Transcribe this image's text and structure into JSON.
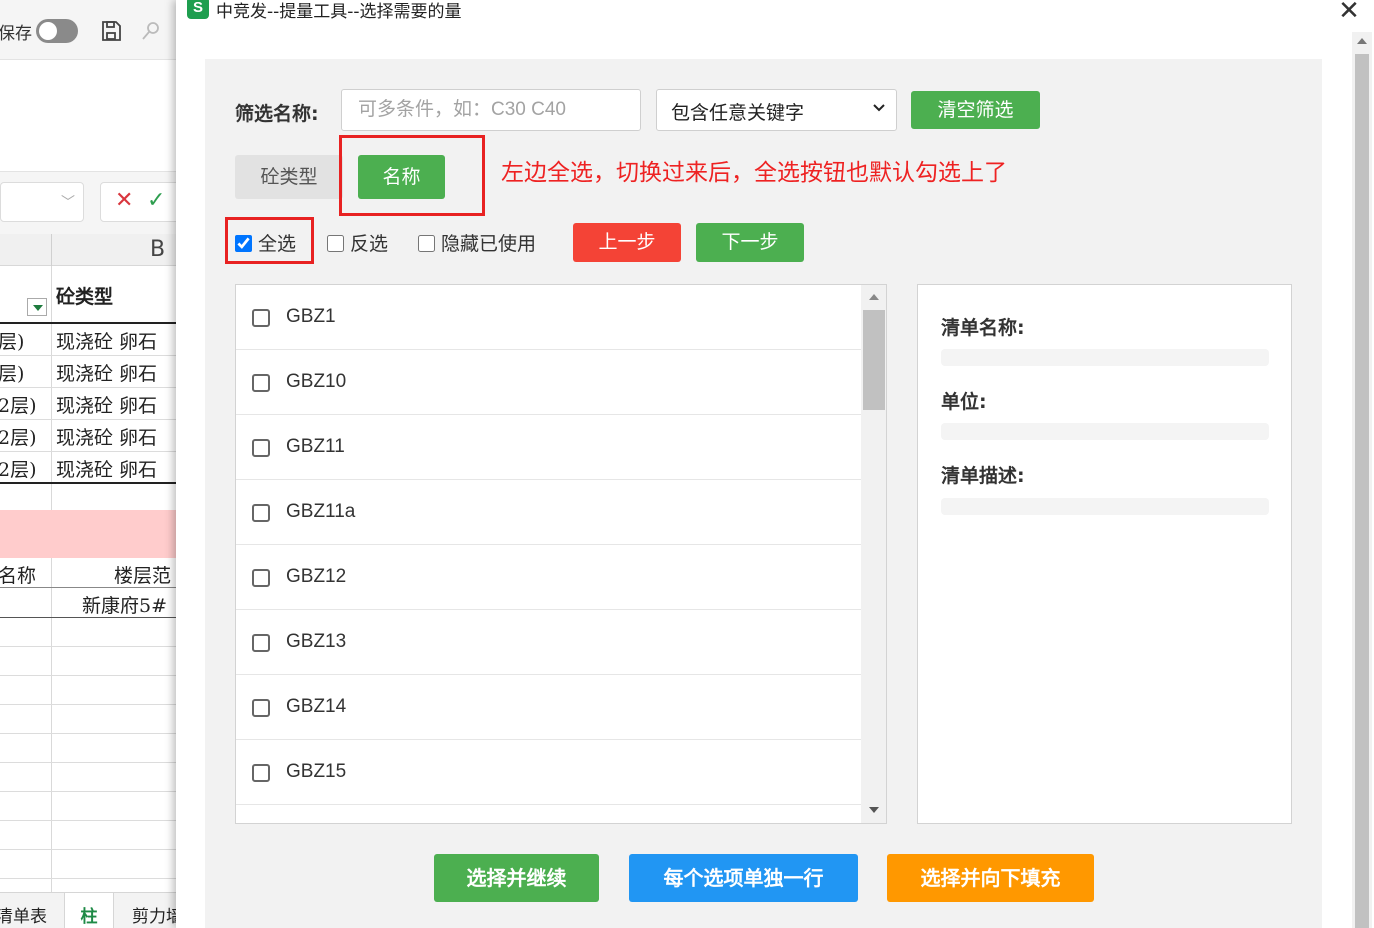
{
  "spreadsheet": {
    "autosave_label": "保存",
    "column_b_header": "B",
    "header_cell": "砼类型",
    "rows": [
      {
        "a": "层)",
        "b": "现浇砼 卵石"
      },
      {
        "a": "层)",
        "b": "现浇砼 卵石"
      },
      {
        "a": "2层)",
        "b": "现浇砼 卵石"
      },
      {
        "a": "2层)",
        "b": "现浇砼 卵石"
      },
      {
        "a": "2层)",
        "b": "现浇砼 卵石"
      }
    ],
    "pink_row": {
      "a": "名称",
      "b": "楼层范"
    },
    "data_row": {
      "a": "",
      "b": "新康府5#"
    },
    "sheet_tabs": [
      "清单表",
      "柱",
      "剪力墙"
    ]
  },
  "dialog": {
    "app_icon_letter": "S",
    "window_title": "中竞发--提量工具--选择需要的量",
    "close_label": "✕",
    "filter": {
      "label": "筛选名称:",
      "placeholder": "可多条件，如：C30 C40",
      "value": "",
      "match_mode": "包含任意关键字",
      "clear_button": "清空筛选"
    },
    "tabs": {
      "type_tab": "砼类型",
      "name_tab": "名称"
    },
    "annotation": "左边全选，切换过来后，全选按钮也默认勾选上了",
    "options": {
      "select_all": "全选",
      "select_all_checked": true,
      "invert": "反选",
      "hide_used": "隐藏已使用",
      "prev_button": "上一步",
      "next_button": "下一步"
    },
    "list_items": [
      "GBZ1",
      "GBZ10",
      "GBZ11",
      "GBZ11a",
      "GBZ12",
      "GBZ13",
      "GBZ14",
      "GBZ15"
    ],
    "details": {
      "name_label": "清单名称:",
      "unit_label": "单位:",
      "desc_label": "清单描述:"
    },
    "actions": {
      "continue_button": "选择并继续",
      "separate_rows_button": "每个选项单独一行",
      "fill_down_button": "选择并向下填充"
    },
    "colors": {
      "green": "#4caf50",
      "red": "#f44336",
      "blue": "#2196f3",
      "orange": "#ff9800",
      "annotation_red": "#e82222"
    }
  }
}
